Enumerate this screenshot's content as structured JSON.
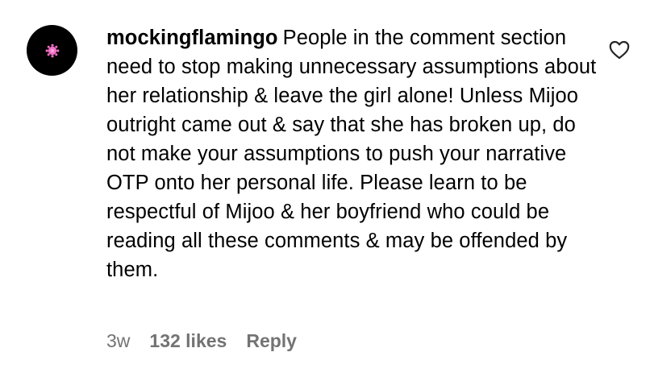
{
  "comment": {
    "username": "mockingflamingo",
    "text": "People in the comment section need to stop making unnecessary assumptions about her relationship & leave the girl alone! Unless Mijoo outright came out & say that she has broken up, do not make your assumptions to push your narrative OTP onto her personal life. Please learn to be respectful of Mijoo & her boyfriend who could be reading all these comments & may be offended by them.",
    "time": "3w",
    "likes": "132 likes",
    "reply_label": "Reply",
    "avatar_icon": "pink-flower-avatar",
    "like_icon": "heart-outline-icon"
  },
  "colors": {
    "avatar_bg": "#000000",
    "avatar_accent": "#f06fc3",
    "meta_text": "#737373"
  }
}
